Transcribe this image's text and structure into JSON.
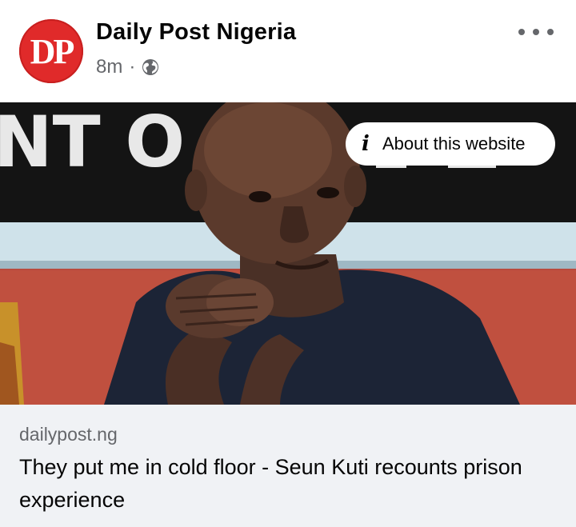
{
  "post": {
    "page_name": "Daily Post Nigeria",
    "avatar_text": "DP",
    "time": "8m",
    "separator": "·",
    "privacy_icon": "globe-icon",
    "more_icon": "more-dots-icon"
  },
  "image": {
    "about_label": "About this website",
    "about_icon": "info-icon",
    "info_glyph": "i",
    "banner_text": "NT O"
  },
  "link": {
    "domain": "dailypost.ng",
    "title": "They put me in cold floor - Seun Kuti recounts prison experience"
  },
  "colors": {
    "brand_red": "#e02a2a",
    "secondary_text": "#65676b",
    "link_background": "#f0f2f5"
  }
}
